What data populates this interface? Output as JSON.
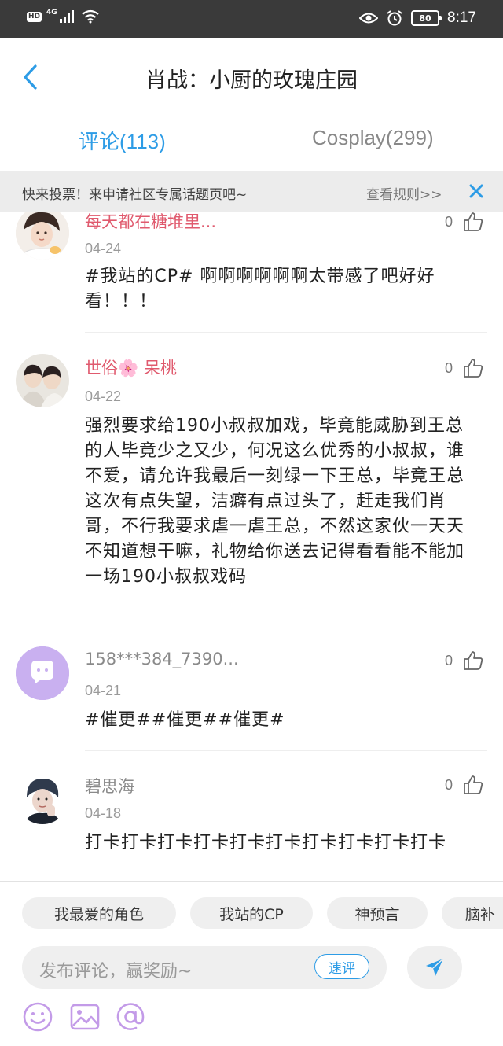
{
  "status_bar": {
    "hd": "HD",
    "network": "4G",
    "battery": "80",
    "time": "8:17"
  },
  "header": {
    "title": "肖战：小厨的玫瑰庄园"
  },
  "tabs": [
    {
      "label": "评论(113)",
      "active": true
    },
    {
      "label": "Cosplay(299)",
      "active": false
    }
  ],
  "notice": {
    "text": "快来投票！来申请社区专属话题页吧~",
    "link": "查看规则>>"
  },
  "comments": [
    {
      "name": "每天都在糖堆里...",
      "date": "04-24",
      "text": "#我站的CP# 啊啊啊啊啊啊太带感了吧好好看！！！",
      "likes": "0",
      "name_color": "#e05a6e"
    },
    {
      "name": "世俗🌸 呆桃",
      "date": "04-22",
      "text": "强烈要求给190小叔叔加戏，毕竟能威胁到王总的人毕竟少之又少，何况这么优秀的小叔叔，谁不爱，请允许我最后一刻绿一下王总，毕竟王总这次有点失望，洁癖有点过头了，赶走我们肖哥，不行我要求虐一虐王总，不然这家伙一天天不知道想干嘛，礼物给你送去记得看看能不能加一场190小叔叔戏码",
      "likes": "0",
      "name_color": "#e05a6e"
    },
    {
      "name": "158***384_7390...",
      "date": "04-21",
      "text": "#催更##催更##催更#",
      "likes": "0",
      "name_color": "#8a8a8a"
    },
    {
      "name": "碧思海",
      "date": "04-18",
      "text": "打卡打卡打卡打卡打卡打卡打卡打卡打卡打卡",
      "likes": "0",
      "name_color": "#8a8a8a"
    }
  ],
  "topic_chips": [
    "我最爱的角色",
    "我站的CP",
    "神预言",
    "脑补"
  ],
  "composer": {
    "placeholder": "发布评论，赢奖励~",
    "quick_label": "速评"
  },
  "colors": {
    "accent": "#2d9ce6",
    "pink_name": "#e05a6e",
    "avatar_purple": "#c9b0f0"
  },
  "icons": [
    "back-arrow-icon",
    "close-icon",
    "thumbs-up-icon",
    "send-icon",
    "emoji-icon",
    "image-icon",
    "at-icon",
    "chat-bubble-icon"
  ]
}
